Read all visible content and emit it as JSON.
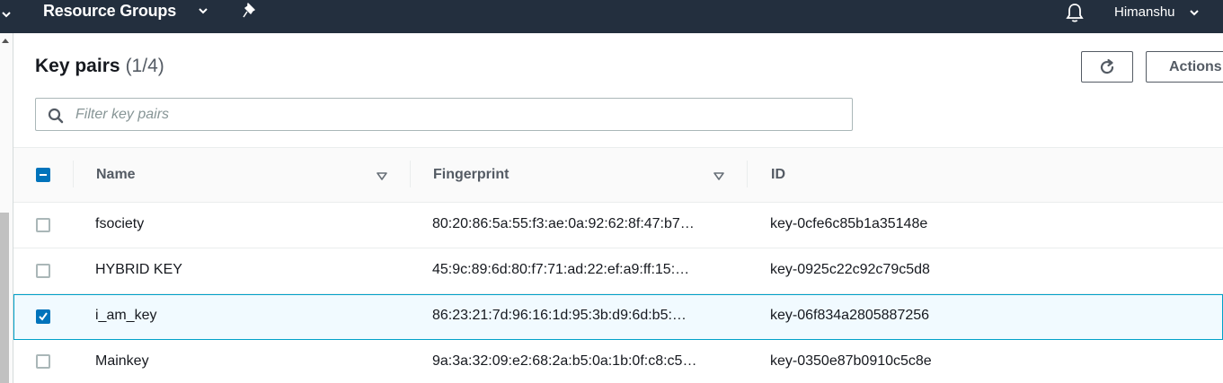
{
  "nav": {
    "resource_groups": "Resource Groups",
    "user": "Himanshu"
  },
  "page": {
    "title": "Key pairs",
    "count": "(1/4)"
  },
  "toolbar": {
    "actions_label": "Actions"
  },
  "search": {
    "placeholder": "Filter key pairs",
    "value": ""
  },
  "table": {
    "columns": [
      "Name",
      "Fingerprint",
      "ID"
    ],
    "rows": [
      {
        "name": "fsociety",
        "fingerprint": "80:20:86:5a:55:f3:ae:0a:92:62:8f:47:b7…",
        "id": "key-0cfe6c85b1a35148e",
        "selected": false
      },
      {
        "name": "HYBRID KEY",
        "fingerprint": "45:9c:89:6d:80:f7:71:ad:22:ef:a9:ff:15:…",
        "id": "key-0925c22c92c79c5d8",
        "selected": false
      },
      {
        "name": "i_am_key",
        "fingerprint": "86:23:21:7d:96:16:1d:95:3b:d9:6d:b5:…",
        "id": "key-06f834a2805887256",
        "selected": true
      },
      {
        "name": "Mainkey",
        "fingerprint": "9a:3a:32:09:e2:68:2a:b5:0a:1b:0f:c8:c5…",
        "id": "key-0350e87b0910c5c8e",
        "selected": false
      }
    ]
  },
  "colors": {
    "nav_bg": "#232f3e",
    "accent": "#0073bb",
    "selected_row_border": "#00a1c9"
  }
}
